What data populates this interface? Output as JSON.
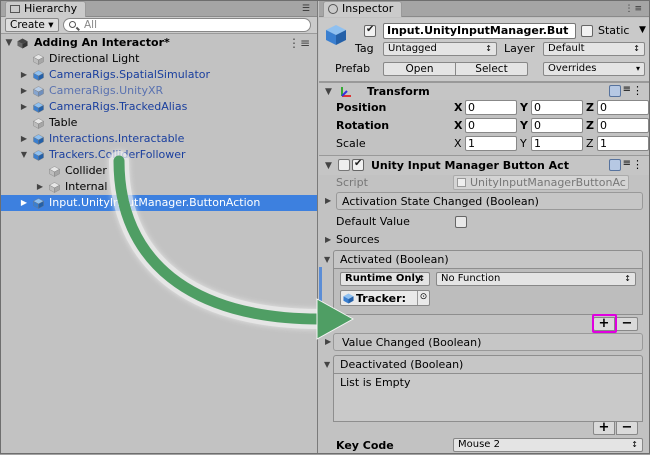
{
  "hierarchy": {
    "tab_label": "Hierarchy",
    "create_label": "Create ▾",
    "search_placeholder": "All",
    "scene_name": "Adding An Interactor*",
    "items": [
      {
        "label": "Directional Light",
        "color": "black",
        "arrow": "",
        "depth": 1
      },
      {
        "label": "CameraRigs.SpatialSimulator",
        "color": "blue",
        "arrow": "▶",
        "depth": 1
      },
      {
        "label": "CameraRigs.UnityXR",
        "color": "dim",
        "arrow": "▶",
        "depth": 1
      },
      {
        "label": "CameraRigs.TrackedAlias",
        "color": "blue",
        "arrow": "▶",
        "depth": 1
      },
      {
        "label": "Table",
        "color": "black",
        "arrow": "",
        "depth": 1
      },
      {
        "label": "Interactions.Interactable",
        "color": "blue",
        "arrow": "▶",
        "depth": 1
      },
      {
        "label": "Trackers.ColliderFollower",
        "color": "blue",
        "arrow": "▼",
        "depth": 1
      },
      {
        "label": "Collider",
        "color": "black",
        "arrow": "",
        "depth": 2
      },
      {
        "label": "Internal",
        "color": "black",
        "arrow": "▶",
        "depth": 2
      },
      {
        "label": "Input.UnityInputManager.ButtonAction",
        "color": "selected",
        "arrow": "▶",
        "depth": 1
      }
    ]
  },
  "inspector": {
    "tab_label": "Inspector",
    "object_name": "Input.UnityInputManager.But",
    "static_label": "Static",
    "tag_label": "Tag",
    "tag_value": "Untagged",
    "layer_label": "Layer",
    "layer_value": "Default",
    "prefab_label": "Prefab",
    "open_label": "Open",
    "select_label": "Select",
    "overrides_label": "Overrides",
    "transform": {
      "title": "Transform",
      "position_label": "Position",
      "rotation_label": "Rotation",
      "scale_label": "Scale",
      "x": "X",
      "y": "Y",
      "z": "Z",
      "position": [
        "0",
        "0",
        "0"
      ],
      "rotation": [
        "0",
        "0",
        "0"
      ],
      "scale": [
        "1",
        "1",
        "1"
      ]
    },
    "component": {
      "title": "Unity Input Manager Button Act",
      "script_label": "Script",
      "script_value": "UnityInputManagerButtonAc",
      "activation_state_changed": "Activation State Changed (Boolean)",
      "default_value_label": "Default Value",
      "sources_label": "Sources",
      "activated_header": "Activated (Boolean)",
      "runtime_only": "Runtime Only",
      "no_function": "No Function",
      "object_ref": "Tracker:",
      "value_changed_header": "Value Changed (Boolean)",
      "deactivated_header": "Deactivated (Boolean)",
      "list_empty": "List is Empty",
      "key_code_label": "Key Code",
      "key_code_value": "Mouse 2"
    },
    "plus_symbol": "+",
    "minus_symbol": "−"
  },
  "colors": {
    "selection": "#3d80df",
    "highlight": "#e000e0",
    "arrow_green": "#4f9e64"
  }
}
